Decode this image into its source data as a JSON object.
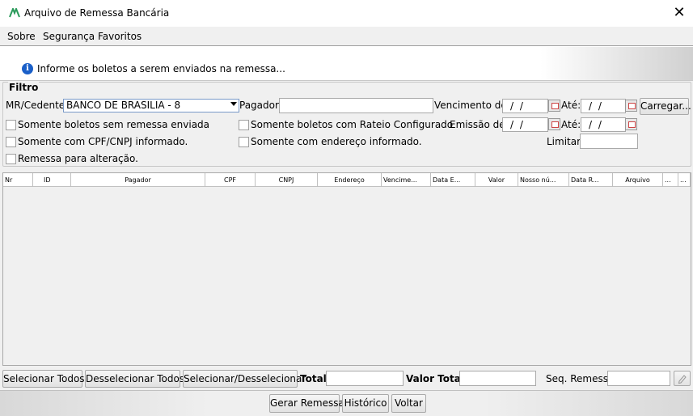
{
  "window": {
    "title": "Arquivo de Remessa Bancária",
    "close_label": "✕"
  },
  "menu": {
    "items": [
      "Sobre",
      "Segurança",
      "Favoritos"
    ]
  },
  "info": {
    "message": "Informe os boletos a serem enviados na remessa...",
    "icon_glyph": "i"
  },
  "filter": {
    "legend": "Filtro",
    "mr_cedente_label": "MR/Cedente:",
    "mr_cedente_value": "BANCO DE BRASILIA - 8",
    "pagador_label": "Pagador:",
    "pagador_value": "",
    "vencimento_label": "Vencimento de:",
    "vencimento_de": "/ /",
    "ate_label": "Até:",
    "vencimento_ate": "/ /",
    "carregar_label": "Carregar...",
    "emissao_label": "Emissão de:",
    "emissao_de": "/ /",
    "emissao_ate": "/ /",
    "limitar_label": "Limitar:",
    "limitar_value": "",
    "checkboxes": {
      "sem_remessa": "Somente boletos sem remessa enviada",
      "rateio": "Somente boletos com Rateio Configurado",
      "cpf_cnpj": "Somente com CPF/CNPJ informado.",
      "endereco": "Somente com endereço informado.",
      "alteracao": "Remessa para alteração."
    }
  },
  "grid": {
    "columns": [
      "Nr",
      "ID",
      "Pagador",
      "CPF",
      "CNPJ",
      "Endereço",
      "Vencime...",
      "Data E...",
      "Valor",
      "Nosso nú...",
      "Data R...",
      "Arquivo",
      "...",
      "..."
    ]
  },
  "bottom": {
    "selecionar_todos": "Selecionar Todos",
    "desselecionar_todos": "Desselecionar Todos",
    "selecionar_desselecionar": "Selecionar/Desselecionar",
    "total_label": "Total:",
    "total_value": "",
    "valor_total_label": "Valor Total:",
    "valor_total_value": "",
    "seq_remessa_label": "Seq. Remessa:",
    "seq_remessa_value": ""
  },
  "footer": {
    "gerar_remessa": "Gerar Remessa",
    "historico": "Histórico",
    "voltar": "Voltar"
  }
}
